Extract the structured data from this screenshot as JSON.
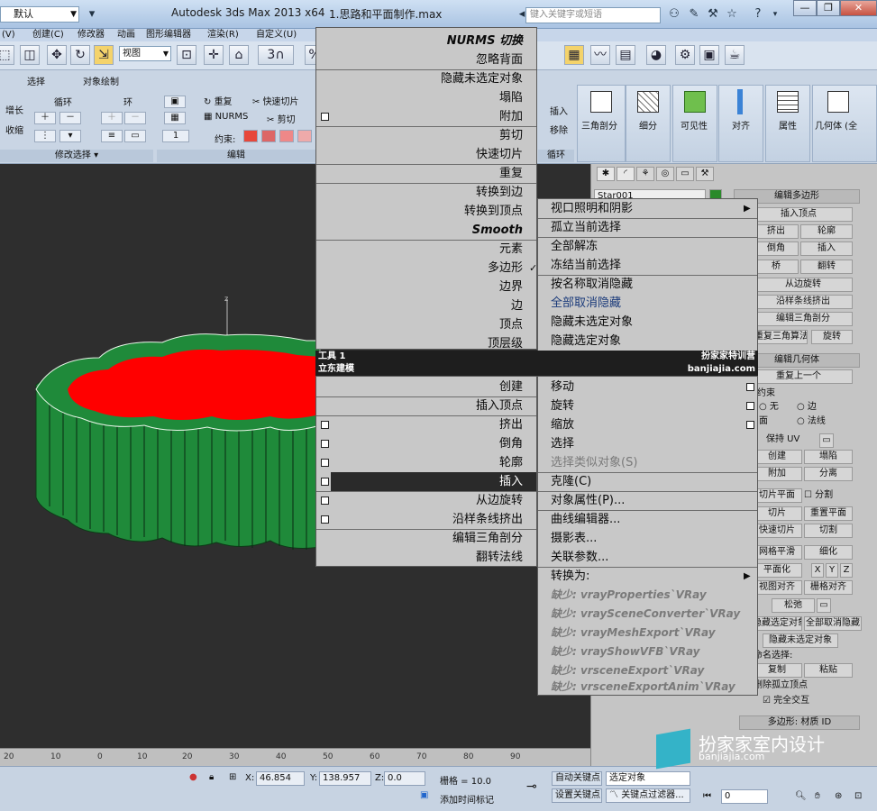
{
  "titlebar": {
    "workspace": "默认",
    "app_title": "Autodesk 3ds Max  2013 x64",
    "file_title": "1.思路和平面制作.max",
    "search_placeholder": "键入关键字或短语"
  },
  "menubar": [
    "(V)",
    "创建(C)",
    "修改器",
    "动画",
    "图形编辑器",
    "渲染(R)",
    "自定义(U)"
  ],
  "toolbar": {
    "view_select": "视图",
    "snap_label": "3"
  },
  "ribbon": {
    "left_labels": [
      "选择",
      "对象绘制"
    ],
    "loop_label": "循环",
    "ring_label": "环",
    "grow_label": "增长",
    "shrink_label": "收缩",
    "repeat_label": "重复",
    "quickslice_label": "快速切片",
    "nurms_label": "NURMS",
    "cut_label": "剪切",
    "constraint_label": "约束:",
    "spinner_value": "1",
    "modify_selection": "修改选择",
    "edit_group": "编辑",
    "insert_label": "插入",
    "remove_label": "移除",
    "loops_footer": "循环",
    "big_buttons": [
      "三角剖分",
      "细分",
      "可见性",
      "对齐",
      "属性",
      "几何体 (全"
    ]
  },
  "viewport": {
    "axis_label": "z",
    "ruler_ticks": [
      "20",
      "10",
      "0",
      "10",
      "20",
      "30",
      "40",
      "50",
      "60",
      "70",
      "80",
      "90"
    ]
  },
  "quad_left_top": {
    "items": [
      {
        "label": "NURMS 切换",
        "italic": true
      },
      {
        "label": "忽略背面",
        "italic": false
      },
      {
        "label": "隐藏未选定对象",
        "italic": false
      },
      {
        "label": "塌陷",
        "italic": false
      },
      {
        "label": "附加",
        "italic": false
      },
      {
        "label": "剪切",
        "italic": false
      },
      {
        "label": "快速切片",
        "italic": false
      },
      {
        "label": "重复",
        "italic": false
      },
      {
        "label": "转换到边",
        "italic": false
      },
      {
        "label": "转换到顶点",
        "italic": false
      },
      {
        "label": "Smooth",
        "italic": true
      },
      {
        "label": "元素",
        "italic": false
      },
      {
        "label": "多边形",
        "italic": false
      },
      {
        "label": "边界",
        "italic": false
      },
      {
        "label": "边",
        "italic": false
      },
      {
        "label": "顶点",
        "italic": false
      },
      {
        "label": "顶层级",
        "italic": false
      }
    ],
    "header_left": "工具 1",
    "header_left2": "立东建模"
  },
  "quad_right_top": {
    "items": [
      "视口照明和阴影",
      "孤立当前选择",
      "全部解冻",
      "冻结当前选择",
      "按名称取消隐藏",
      "全部取消隐藏",
      "隐藏未选定对象",
      "隐藏选定对象"
    ],
    "header_right": "扮家家特训营",
    "header_right2": "banjiajia.com"
  },
  "quad_left_bottom": {
    "items": [
      "创建",
      "插入顶点",
      "挤出",
      "倒角",
      "轮廓",
      "插入",
      "从边旋转",
      "沿样条线挤出",
      "编辑三角剖分",
      "翻转法线"
    ]
  },
  "quad_right_bottom": {
    "items": [
      "移动",
      "旋转",
      "缩放",
      "选择",
      "选择类似对象(S)",
      "克隆(C)",
      "对象属性(P)...",
      "曲线编辑器...",
      "摄影表...",
      "关联参数...",
      "转换为:"
    ],
    "missing": [
      "缺少: vrayProperties`VRay",
      "缺少: vraySceneConverter`VRay",
      "缺少: vrayMeshExport`VRay",
      "缺少: vrayShowVFB`VRay",
      "缺少: vrsceneExport`VRay",
      "缺少: vrsceneExportAnim`VRay"
    ]
  },
  "command_panel": {
    "object_name": "Star001",
    "rollout": "编辑多边形",
    "insert_vertex": "插入顶点",
    "extrude": "挤出",
    "outline": "轮廓",
    "bevel": "倒角",
    "inset": "插入",
    "bridge": "桥",
    "flip": "翻转",
    "hinge": "从边旋转",
    "extrude_spline": "沿样条线挤出",
    "edit_tri": "编辑三角剖分",
    "retri": "重复三角算法",
    "turn": "旋转",
    "edit_geom": "编辑几何体",
    "repeat_last": "重复上一个",
    "constraints": "约束",
    "none": "无",
    "edge": "边",
    "face": "面",
    "normal": "法线",
    "preserve_uv": "保持 UV",
    "create": "创建",
    "collapse": "塌陷",
    "attach": "附加",
    "detach": "分离",
    "slice_plane": "切片平面",
    "split": "分割",
    "slice": "切片",
    "reset_plane": "重置平面",
    "quickslice": "快速切片",
    "cut": "切割",
    "msmooth": "网格平滑",
    "tessellate": "细化",
    "make_planar": "平面化",
    "x": "X",
    "y": "Y",
    "z": "Z",
    "view_align": "视图对齐",
    "grid_align": "栅格对齐",
    "relax": "松弛",
    "hide_sel": "隐藏选定对象",
    "unhide_all": "全部取消隐藏",
    "hide_unsel": "隐藏未选定对象",
    "named_sel": "命名选择:",
    "copy": "复制",
    "paste": "粘贴",
    "delete_iso": "删除孤立顶点",
    "full_interact": "完全交互",
    "poly_mat": "多边形: 材质 ID"
  },
  "statusbar": {
    "x_label": "X:",
    "x_value": "46.854",
    "y_label": "Y:",
    "y_value": "138.957",
    "z_label": "Z:",
    "z_value": "0.0",
    "grid": "栅格 = 10.0",
    "auto_key": "自动关键点",
    "selected": "选定对象",
    "set_key": "设置关键点",
    "key_filters": "关键点过滤器...",
    "add_time_tag": "添加时间标记",
    "frame": "0"
  },
  "watermark": {
    "text": "扮家家室内设计",
    "url": "banjiajia.com"
  },
  "colors": {
    "red_top": "#ff0000",
    "green_side": "#1f8a3a",
    "menu_bg": "#c8c8c8",
    "highlight": "#2a2a2a"
  }
}
